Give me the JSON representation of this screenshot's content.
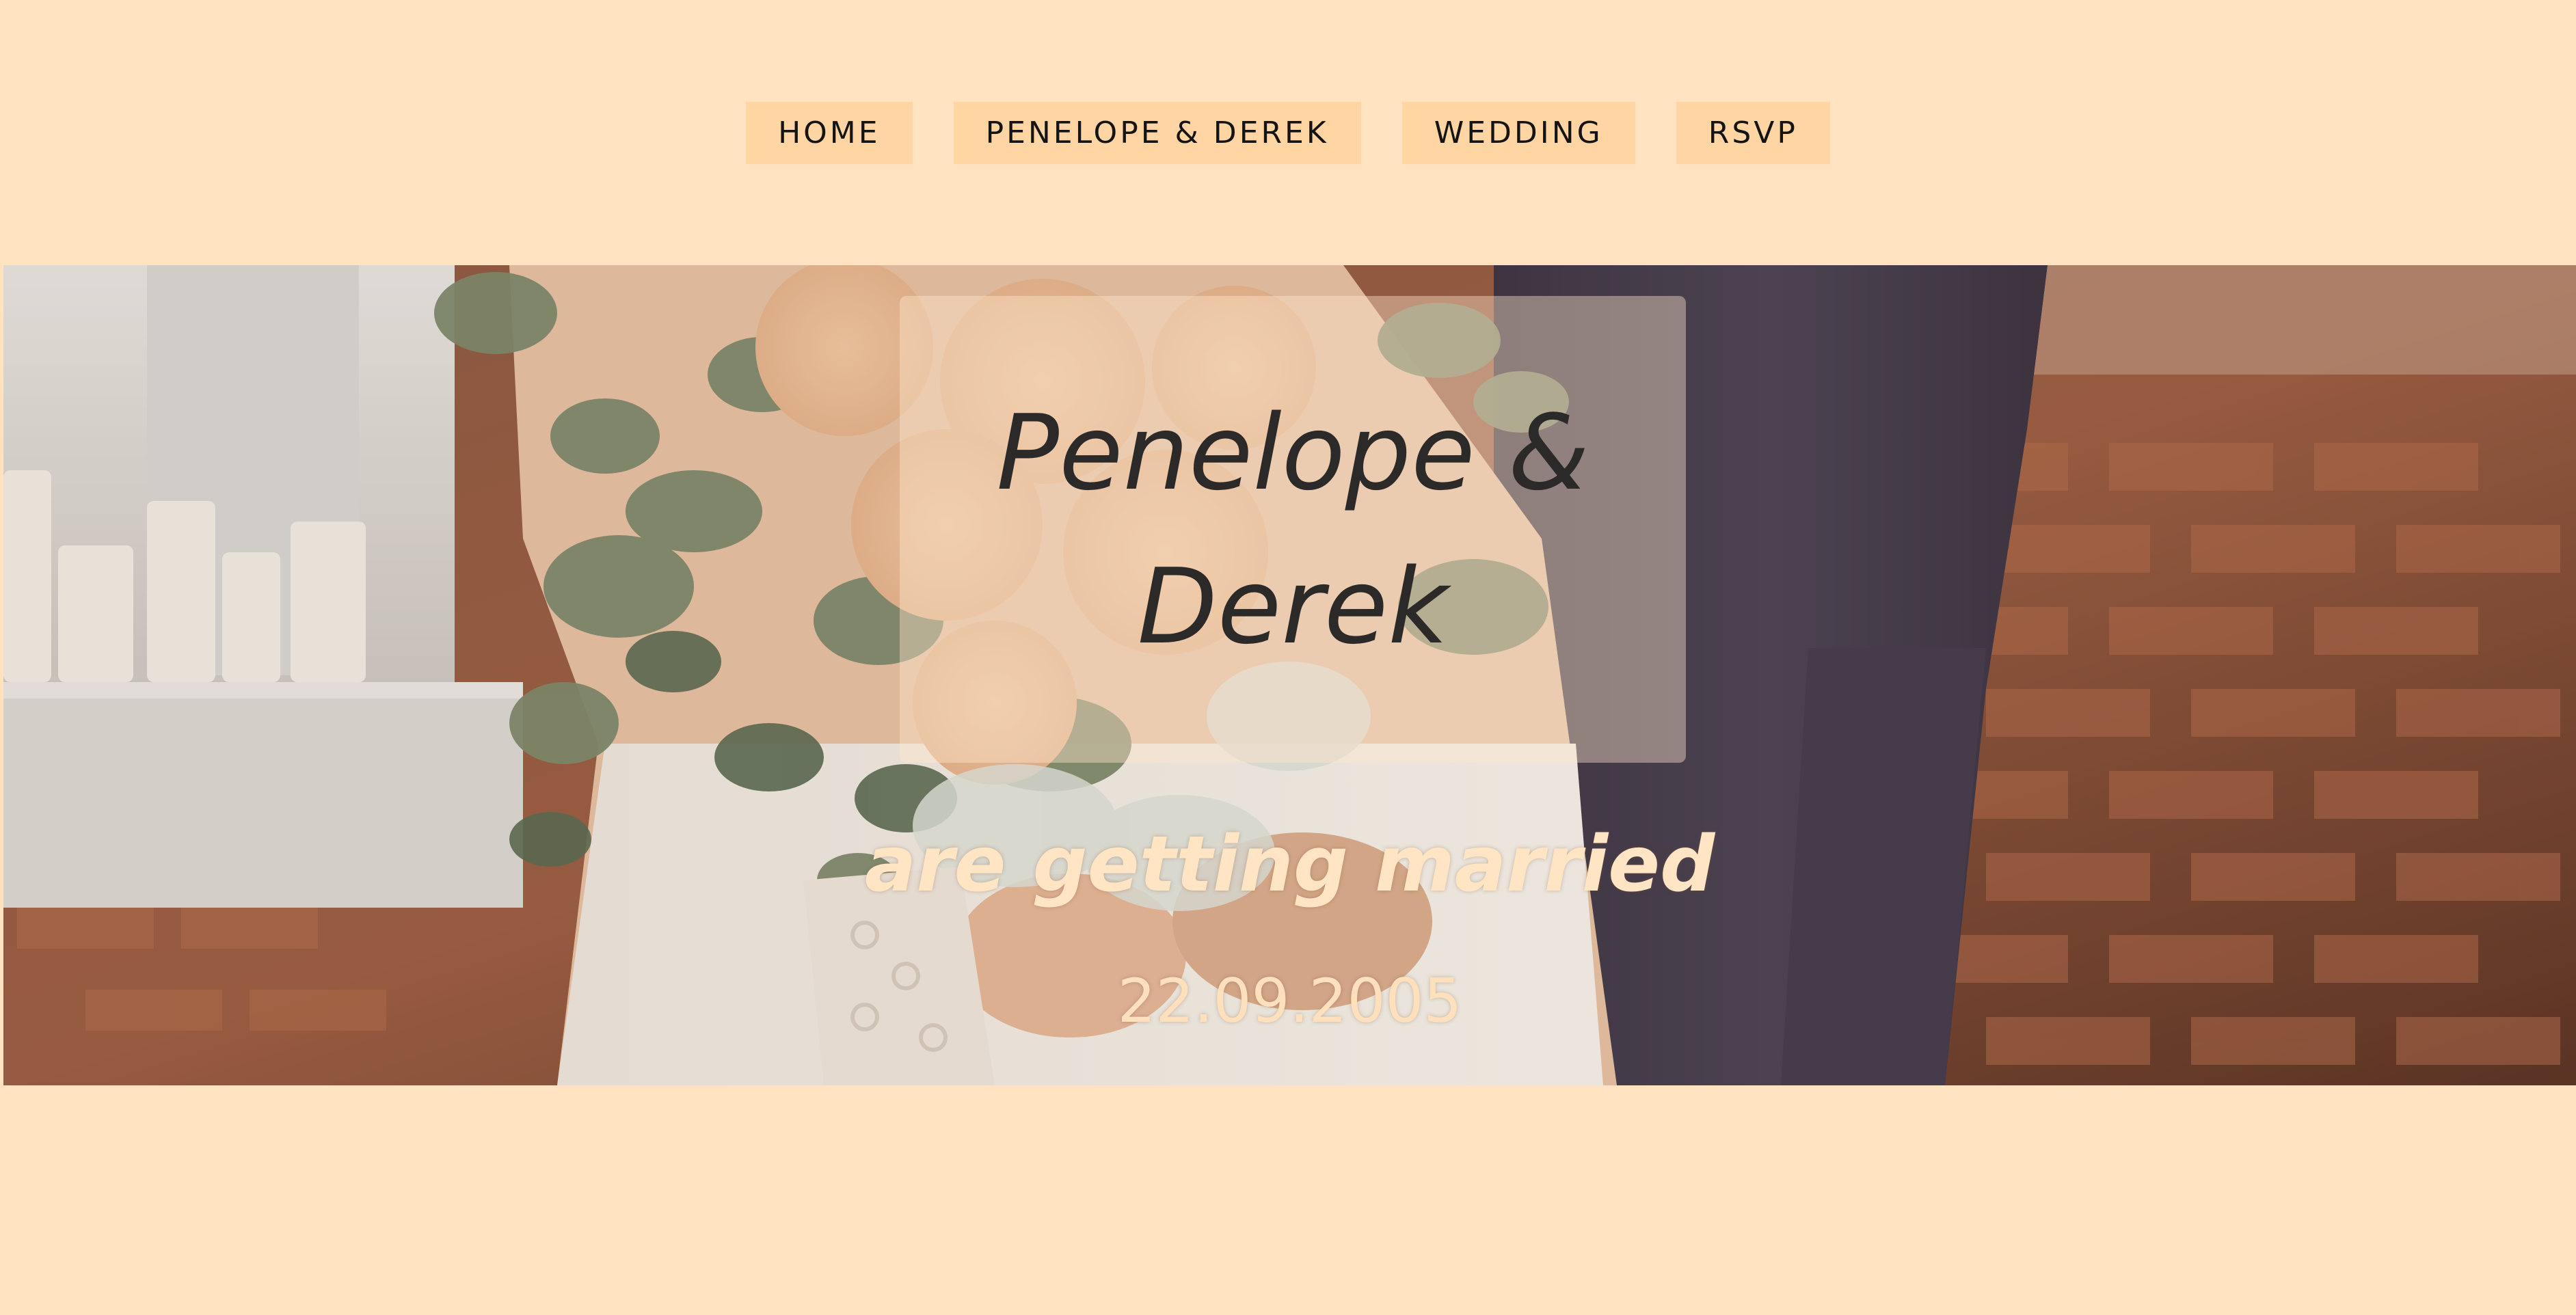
{
  "nav": {
    "items": [
      {
        "label": "HOME"
      },
      {
        "label": "PENELOPE & DEREK"
      },
      {
        "label": "WEDDING"
      },
      {
        "label": "RSVP"
      }
    ]
  },
  "hero": {
    "couple_name": "Penelope & Derek",
    "tagline": "are getting married",
    "date": "22.09.2005"
  },
  "colors": {
    "page_background": "#ffe3c1",
    "nav_button": "#ffd5a3",
    "nav_text": "#141414",
    "title_text": "#2c2a29",
    "accent_text": "#ffe5c4"
  },
  "icons": [
    "wedding-photo"
  ]
}
